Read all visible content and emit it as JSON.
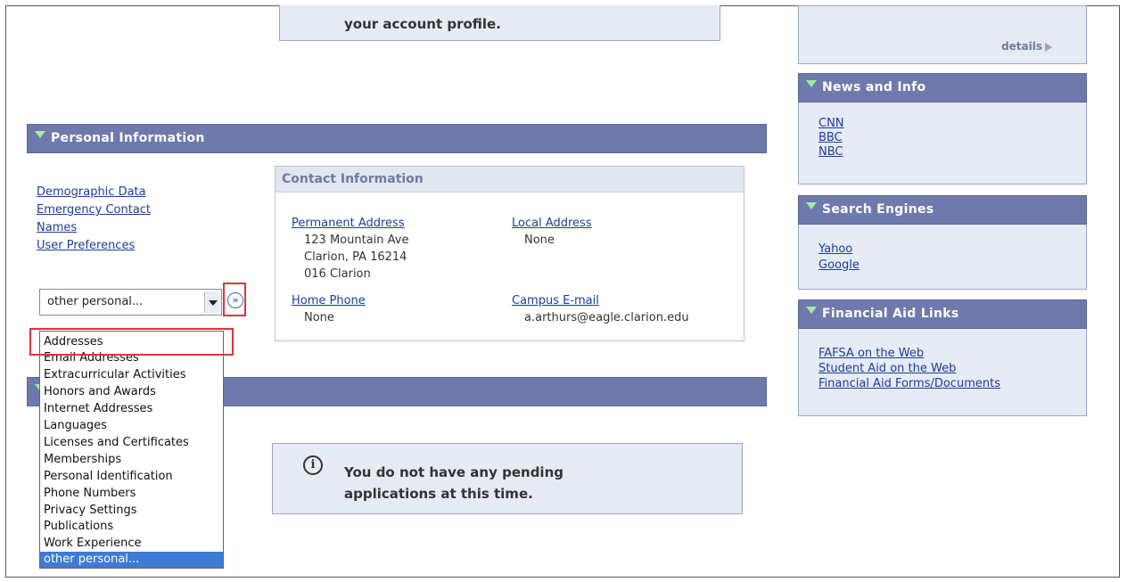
{
  "top_message": "your account profile.",
  "personal_section": {
    "title": "Personal Information",
    "links": [
      "Demographic Data",
      "Emergency Contact",
      "Names",
      "User Preferences"
    ]
  },
  "contact": {
    "title": "Contact Information",
    "permanent_address_label": "Permanent Address",
    "permanent_address_lines": [
      "123 Mountain Ave",
      "Clarion, PA 16214",
      "016 Clarion"
    ],
    "local_address_label": "Local Address",
    "local_address_value": "None",
    "home_phone_label": "Home Phone",
    "home_phone_value": "None",
    "campus_email_label": "Campus E-mail",
    "campus_email_value": "a.arthurs@eagle.clarion.edu"
  },
  "select": {
    "value": "other personal...",
    "go_glyph": "»",
    "options": [
      "Addresses",
      "Email Addresses",
      "Extracurricular Activities",
      "Honors and Awards",
      "Internet Addresses",
      "Languages",
      "Licenses and Certificates",
      "Memberships",
      "Personal Identification",
      "Phone Numbers",
      "Privacy Settings",
      "Publications",
      "Work Experience",
      "other personal..."
    ]
  },
  "pending": {
    "icon": "i",
    "line1": "You do not have any pending",
    "line2": "applications at this time."
  },
  "right": {
    "details_label": "details",
    "news": {
      "title": "News and Info",
      "links": [
        "CNN",
        "BBC",
        "NBC"
      ]
    },
    "search": {
      "title": "Search Engines",
      "links": [
        "Yahoo",
        "Google"
      ]
    },
    "finaid": {
      "title": "Financial Aid Links",
      "links": [
        "FAFSA on the Web",
        "Student Aid on the Web",
        "Financial Aid Forms/Documents"
      ]
    }
  },
  "colors": {
    "header_bar": "#6e7aac",
    "panel_bg": "#e6ebf5",
    "link": "#1a3d9a",
    "highlight": "#d9363e",
    "selected_option": "#3e7ad6"
  }
}
